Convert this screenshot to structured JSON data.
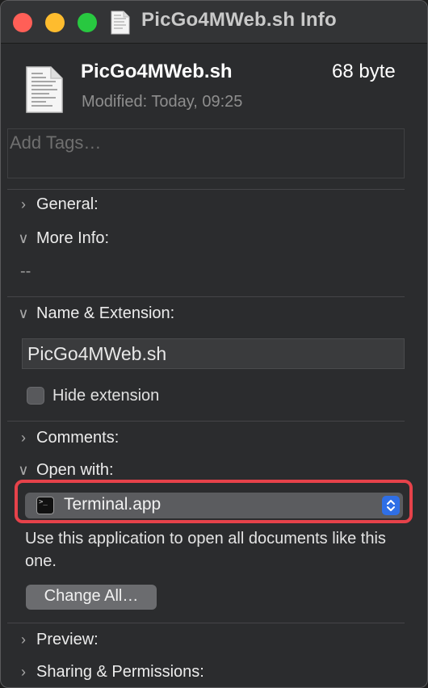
{
  "window": {
    "title": "PicGo4MWeb.sh Info"
  },
  "file": {
    "name": "PicGo4MWeb.sh",
    "size": "68 byte",
    "modified": "Modified: Today, 09:25"
  },
  "tags": {
    "placeholder": "Add Tags…"
  },
  "sections": {
    "general": "General:",
    "more_info": "More Info:",
    "more_info_value": "--",
    "name_extension": "Name & Extension:",
    "name_value": "PicGo4MWeb.sh",
    "hide_extension": "Hide extension",
    "comments": "Comments:",
    "open_with": "Open with:",
    "open_with_app": "Terminal.app",
    "open_with_desc": "Use this application to open all documents like this one.",
    "change_all": "Change All…",
    "preview": "Preview:",
    "sharing": "Sharing & Permissions:"
  },
  "colors": {
    "highlight": "#e6424a",
    "stepper": "#2f6fe6"
  }
}
